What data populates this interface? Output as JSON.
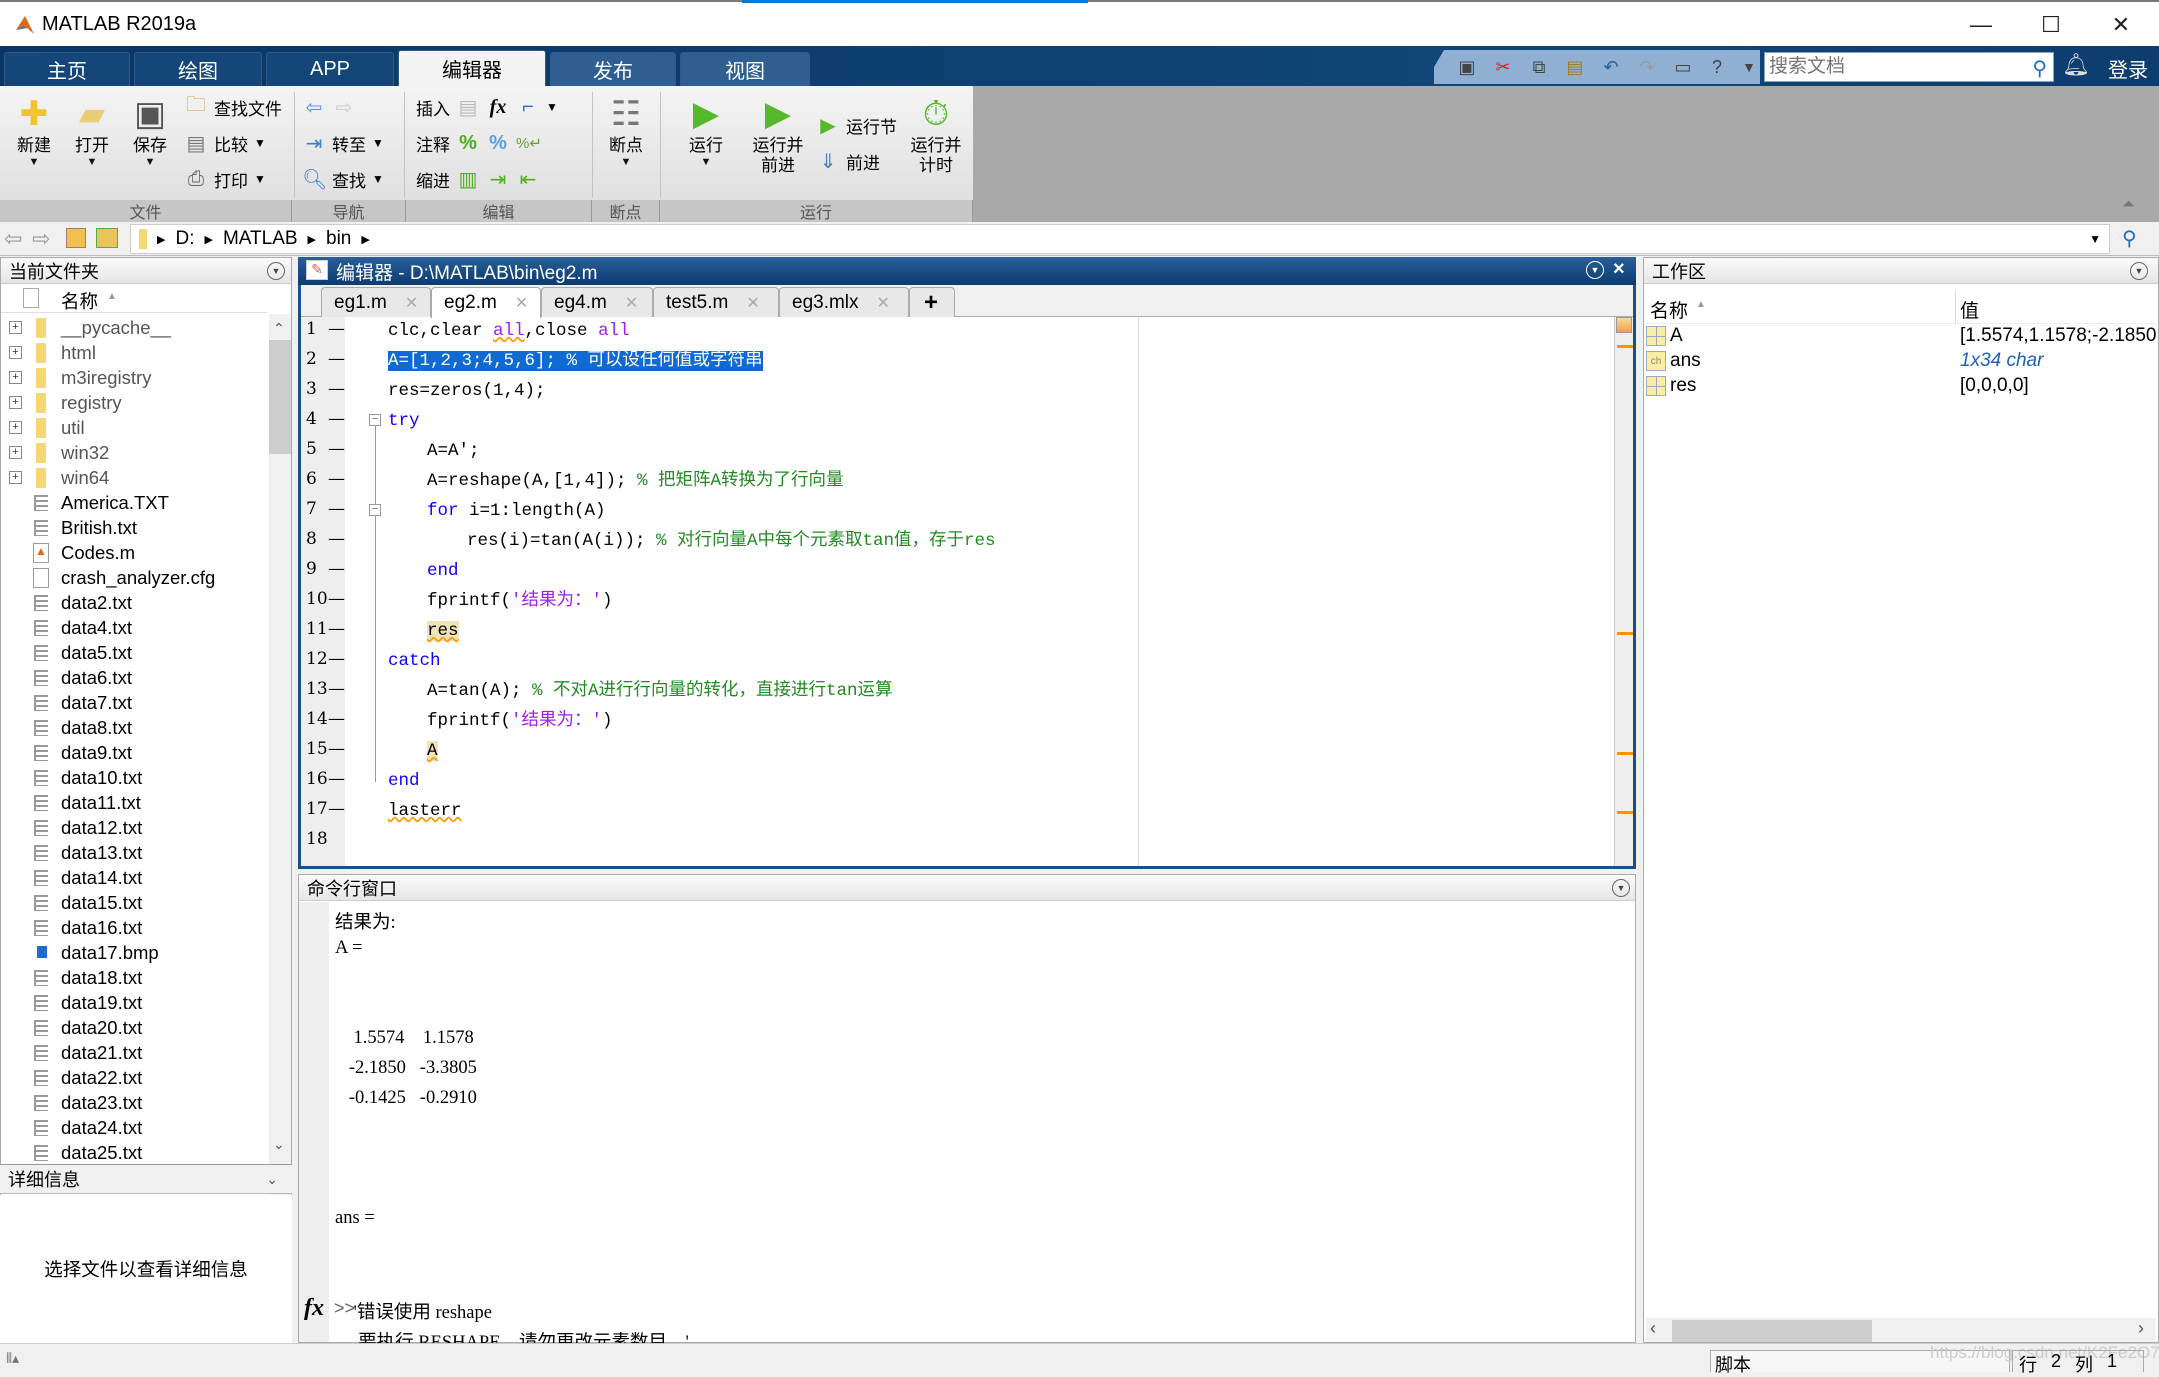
{
  "window": {
    "title": "MATLAB R2019a",
    "controls": {
      "minimize": "—",
      "maximize": "☐",
      "close": "✕"
    }
  },
  "tabs": [
    {
      "label": "主页"
    },
    {
      "label": "绘图"
    },
    {
      "label": "APP"
    },
    {
      "label": "编辑器",
      "active": true
    },
    {
      "label": "发布"
    },
    {
      "label": "视图"
    }
  ],
  "quick_access": [
    "save-icon",
    "cut-icon",
    "copy-icon",
    "paste-icon",
    "undo-icon",
    "redo-icon",
    "switch-windows-icon",
    "help-icon",
    "more-icon"
  ],
  "search": {
    "placeholder": "搜索文档",
    "login": "登录"
  },
  "ribbon": {
    "file": {
      "new": "新建",
      "open": "打开",
      "save": "保存",
      "find_files": "查找文件",
      "compare": "比较",
      "print": "打印",
      "group": "文件"
    },
    "navigate": {
      "goto": "转至",
      "find": "查找",
      "group": "导航"
    },
    "edit": {
      "insert": "插入",
      "comment": "注释",
      "indent": "缩进",
      "fx": "fx",
      "group": "编辑"
    },
    "breakpoints": {
      "label": "断点",
      "group": "断点"
    },
    "run": {
      "run": "运行",
      "run_advance": "运行并\n前进",
      "run_advance_1": "运行并",
      "run_advance_2": "前进",
      "run_section": "运行节",
      "advance": "前进",
      "run_time_1": "运行并",
      "run_time_2": "计时",
      "group": "运行"
    }
  },
  "address": {
    "crumbs": [
      "D:",
      "MATLAB",
      "bin"
    ]
  },
  "current_folder": {
    "title": "当前文件夹",
    "column": "名称",
    "folders": [
      "__pycache__",
      "html",
      "m3iregistry",
      "registry",
      "util",
      "win32",
      "win64"
    ],
    "files": [
      {
        "name": "America.TXT",
        "type": "txt"
      },
      {
        "name": "British.txt",
        "type": "txt"
      },
      {
        "name": "Codes.m",
        "type": "m"
      },
      {
        "name": "crash_analyzer.cfg",
        "type": "cfg"
      },
      {
        "name": "data2.txt",
        "type": "txt"
      },
      {
        "name": "data4.txt",
        "type": "txt"
      },
      {
        "name": "data5.txt",
        "type": "txt"
      },
      {
        "name": "data6.txt",
        "type": "txt"
      },
      {
        "name": "data7.txt",
        "type": "txt"
      },
      {
        "name": "data8.txt",
        "type": "txt"
      },
      {
        "name": "data9.txt",
        "type": "txt"
      },
      {
        "name": "data10.txt",
        "type": "txt"
      },
      {
        "name": "data11.txt",
        "type": "txt"
      },
      {
        "name": "data12.txt",
        "type": "txt"
      },
      {
        "name": "data13.txt",
        "type": "txt"
      },
      {
        "name": "data14.txt",
        "type": "txt"
      },
      {
        "name": "data15.txt",
        "type": "txt"
      },
      {
        "name": "data16.txt",
        "type": "txt"
      },
      {
        "name": "data17.bmp",
        "type": "bmp"
      },
      {
        "name": "data18.txt",
        "type": "txt"
      },
      {
        "name": "data19.txt",
        "type": "txt"
      },
      {
        "name": "data20.txt",
        "type": "txt"
      },
      {
        "name": "data21.txt",
        "type": "txt"
      },
      {
        "name": "data22.txt",
        "type": "txt"
      },
      {
        "name": "data23.txt",
        "type": "txt"
      },
      {
        "name": "data24.txt",
        "type": "txt"
      },
      {
        "name": "data25.txt",
        "type": "txt"
      }
    ],
    "details_title": "详细信息",
    "details_text": "选择文件以查看详细信息"
  },
  "editor": {
    "title": "编辑器 - D:\\MATLAB\\bin\\eg2.m",
    "tabs": [
      {
        "label": "eg1.m"
      },
      {
        "label": "eg2.m",
        "active": true
      },
      {
        "label": "eg4.m"
      },
      {
        "label": "test5.m"
      },
      {
        "label": "eg3.mlx"
      }
    ],
    "add_tab": "+",
    "lines": [
      {
        "n": "1",
        "code": "clc,clear all,close all"
      },
      {
        "n": "2",
        "code": "A=[1,2,3;4,5,6]; % 可以设任何值或字符串"
      },
      {
        "n": "3",
        "code": "res=zeros(1,4);"
      },
      {
        "n": "4",
        "code": "try"
      },
      {
        "n": "5",
        "code": "A=A';"
      },
      {
        "n": "6",
        "code": "A=reshape(A,[1,4]); % 把矩阵A转换为了行向量"
      },
      {
        "n": "7",
        "code": "for i=1:length(A)"
      },
      {
        "n": "8",
        "code": "res(i)=tan(A(i)); % 对行向量A中每个元素取tan值，存于res"
      },
      {
        "n": "9",
        "code": "end"
      },
      {
        "n": "10",
        "code": "fprintf('结果为：')"
      },
      {
        "n": "11",
        "code": "res"
      },
      {
        "n": "12",
        "code": "catch"
      },
      {
        "n": "13",
        "code": "A=tan(A); % 不对A进行行向量的转化，直接进行tan运算"
      },
      {
        "n": "14",
        "code": "fprintf('结果为：')"
      },
      {
        "n": "15",
        "code": "A"
      },
      {
        "n": "16",
        "code": "end"
      },
      {
        "n": "17",
        "code": "lasterr"
      },
      {
        "n": "18",
        "code": ""
      }
    ],
    "tokens": {
      "l1a": "clc,clear ",
      "l1b": "all",
      "l1c": ",close ",
      "l1d": "all",
      "l2": "A=[1,2,3;4,5,6]; % 可以设任何值或字符串",
      "l3": "res=zeros(1,4);",
      "l4": "try",
      "l5": "A=A';",
      "l6a": "A=reshape(A,[1,4]); ",
      "l6b": "% 把矩阵A转换为了行向量",
      "l7a": "for",
      "l7b": " i=1:length(A)",
      "l8a": "res(i)=tan(A(i)); ",
      "l8b": "% 对行向量A中每个元素取tan值，存于res",
      "l9": "end",
      "l10a": "fprintf(",
      "l10b": "'结果为：'",
      "l10c": ")",
      "l11": "res",
      "l12": "catch",
      "l13a": "A=tan(A); ",
      "l13b": "% 不对A进行行向量的转化，直接进行tan运算",
      "l14a": "fprintf(",
      "l14b": "'结果为：'",
      "l14c": ")",
      "l15": "A",
      "l16": "end",
      "l17": "lasterr"
    }
  },
  "command_window": {
    "title": "命令行窗口",
    "output": [
      "结果为:",
      "A =",
      "",
      "",
      "    1.5574    1.1578",
      "   -2.1850   -3.3805",
      "   -0.1425   -0.2910",
      "",
      "",
      "",
      "ans =",
      "",
      "",
      "    '错误使用 reshape",
      "     要执行 RESHAPE，请勿更改元素数目。'"
    ],
    "prompt": ">>"
  },
  "workspace": {
    "title": "工作区",
    "columns": {
      "name": "名称",
      "value": "值"
    },
    "variables": [
      {
        "name": "A",
        "value": "[1.5574,1.1578;-2.1850",
        "kind": "matrix"
      },
      {
        "name": "ans",
        "value": "1x34 char",
        "kind": "char"
      },
      {
        "name": "res",
        "value": "[0,0,0,0]",
        "kind": "matrix"
      }
    ]
  },
  "status": {
    "mode": "脚本",
    "row_label": "行",
    "row": "2",
    "col_label": "列",
    "col": "1",
    "watermark": "https://blog.csdn.net/K2Fe2O7"
  }
}
